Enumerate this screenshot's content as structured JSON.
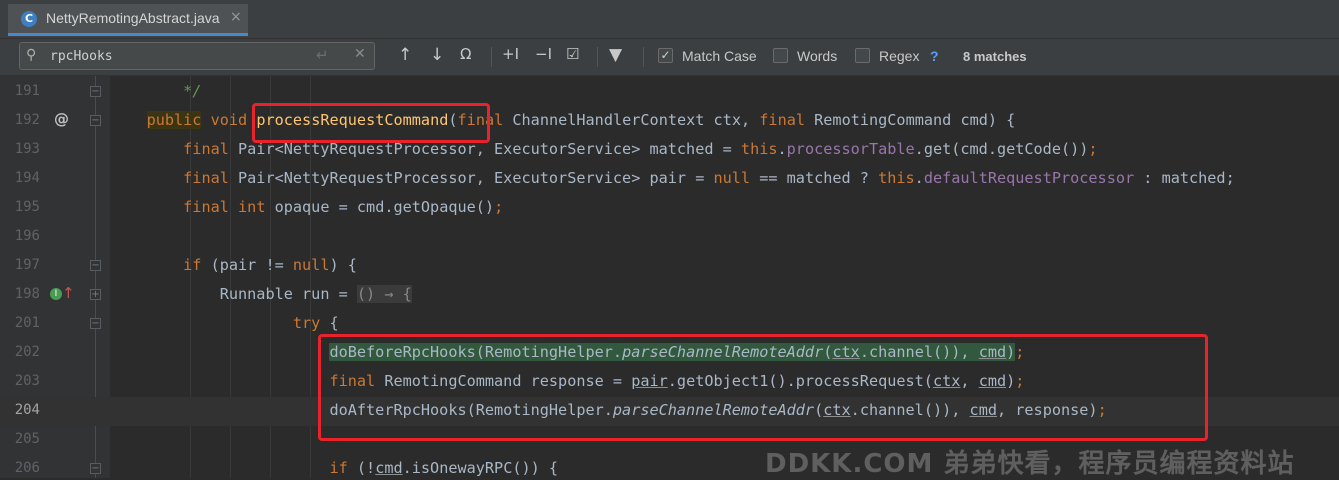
{
  "tab": {
    "label": "NettyRemotingAbstract.java",
    "icon": "class-c-icon",
    "close": "×"
  },
  "find": {
    "query": "rpcHooks",
    "options": [
      {
        "label": "Match Case",
        "checked": true
      },
      {
        "label": "Words",
        "checked": false
      },
      {
        "label": "Regex",
        "checked": false
      }
    ],
    "help": "?",
    "matches": "8 matches"
  },
  "gutter": {
    "annotation_at": "@",
    "line_numbers": [
      "191",
      "192",
      "193",
      "194",
      "195",
      "196",
      "197",
      "198",
      "201",
      "202",
      "203",
      "204",
      "205",
      "206"
    ]
  },
  "colors": {
    "editor_bg": "#2b2b2b",
    "keyword": "#cc7832",
    "field": "#9876aa",
    "comment": "#629755",
    "highlight_green": "#32593d",
    "annotation_box": "#e8232b"
  },
  "code": {
    "l191": {
      "comment": "*/"
    },
    "l192": {
      "kw1": "public",
      "kw2": "void",
      "method": "processRequestCommand",
      "p1": "(",
      "kw3": "final",
      "t1": " ChannelHandlerContext ctx, ",
      "kw4": "final",
      "t2": " RemotingCommand cmd) {"
    },
    "l193": {
      "kw": "final",
      "t1": " Pair<NettyRequestProcessor, ExecutorService> matched = ",
      "this": "this",
      "dot": ".",
      "field": "processorTable",
      "t2": ".get(cmd.getCode())",
      "semi": ";"
    },
    "l194": {
      "kw": "final",
      "t1": " Pair<NettyRequestProcessor, ExecutorService> pair = ",
      "nul": "null",
      "t2": " == matched ? ",
      "this": "this",
      "dot": ".",
      "field": "defaultRequestProcessor",
      "t3": " : matched;"
    },
    "l195": {
      "kw1": "final",
      "kw2": "int",
      "t1": " opaque = cmd.getOpaque()",
      "semi": ";"
    },
    "l197": {
      "kw": "if",
      "t1": " (pair != ",
      "nul": "null",
      "t2": ") {"
    },
    "l198": {
      "t1": "Runnable run = ",
      "lambda": "() → {"
    },
    "l201": {
      "kw": "try",
      "t1": " {"
    },
    "l202": {
      "t1": "doBeforeRpcHooks(RemotingHelper.",
      "m": "parseChannelRemoteAddr",
      "p1": "(",
      "ctx": "ctx",
      "t2": ".channel()), ",
      "cmd": "cmd",
      "p2": ")",
      "semi": ";"
    },
    "l203": {
      "kw": "final",
      "t1": " RemotingCommand response = ",
      "pair": "pair",
      "t2": ".getObject1().processRequest(",
      "ctx": "ctx",
      "t3": ", ",
      "cmd": "cmd",
      "p2": ")",
      "semi": ";"
    },
    "l204": {
      "t1": "doAfterRpcHooks(RemotingHelper.",
      "m": "parseChannelRemoteAddr",
      "p1": "(",
      "ctx": "ctx",
      "t2": ".channel()), ",
      "cmd": "cmd",
      "t3": ", response)",
      "semi": ";"
    },
    "l206": {
      "kw": "if",
      "t1": " (!",
      "cmd": "cmd",
      "t2": ".isOnewayRPC()) {"
    }
  },
  "watermark": "DDKK.COM 弟弟快看，程序员编程资料站"
}
